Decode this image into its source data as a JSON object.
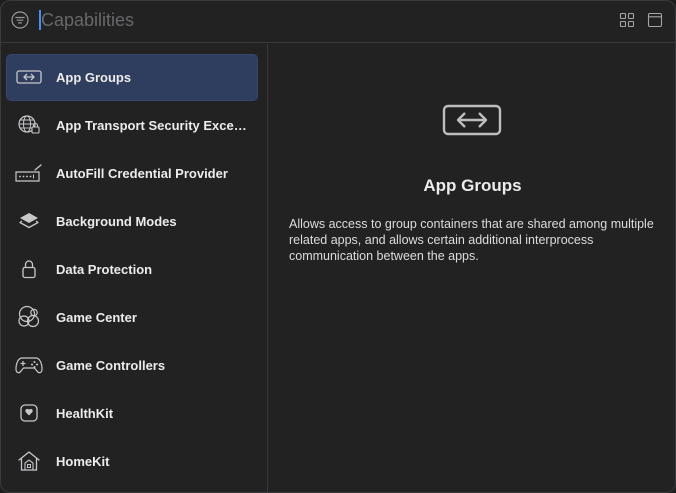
{
  "search": {
    "placeholder": "Capabilities",
    "value": ""
  },
  "toolbar": {
    "filter_icon": "filter-circle-icon",
    "grid_icon": "grid-view-icon",
    "panel_icon": "panel-view-icon"
  },
  "sidebar": {
    "selected_index": 0,
    "items": [
      {
        "label": "App Groups",
        "icon": "app-groups-icon"
      },
      {
        "label": "App Transport Security Exception",
        "icon": "globe-lock-icon"
      },
      {
        "label": "AutoFill Credential Provider",
        "icon": "password-field-icon"
      },
      {
        "label": "Background Modes",
        "icon": "layers-icon"
      },
      {
        "label": "Data Protection",
        "icon": "lock-icon"
      },
      {
        "label": "Game Center",
        "icon": "game-center-icon"
      },
      {
        "label": "Game Controllers",
        "icon": "gamecontroller-icon"
      },
      {
        "label": "HealthKit",
        "icon": "heart-icon"
      },
      {
        "label": "HomeKit",
        "icon": "home-icon"
      }
    ]
  },
  "detail": {
    "title": "App Groups",
    "icon": "app-groups-icon",
    "description": "Allows access to group containers that are shared among multiple related apps, and allows certain additional interprocess communication between the apps."
  },
  "colors": {
    "selection": "#2f3d5e",
    "caret": "#4a8cf7",
    "background": "#222223"
  }
}
